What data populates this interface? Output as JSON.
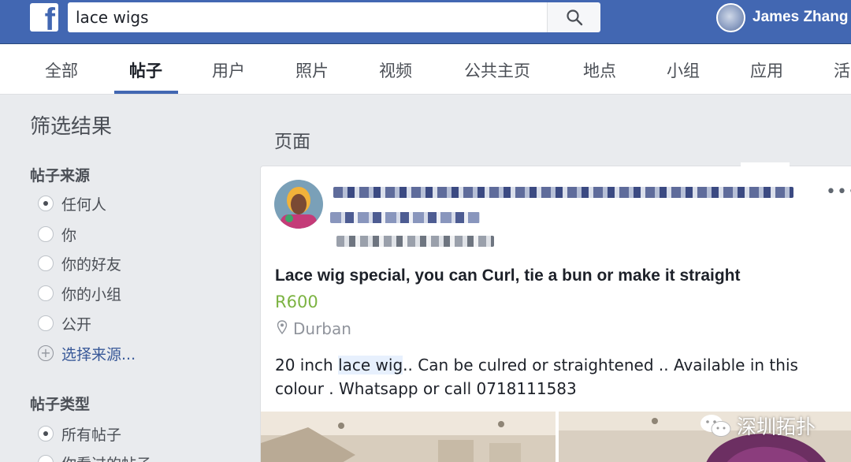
{
  "header": {
    "logo": "f",
    "search_value": "lace wigs",
    "user_name": "James Zhang"
  },
  "tabs": [
    {
      "label": "全部"
    },
    {
      "label": "帖子"
    },
    {
      "label": "用户"
    },
    {
      "label": "照片"
    },
    {
      "label": "视频"
    },
    {
      "label": "公共主页"
    },
    {
      "label": "地点"
    },
    {
      "label": "小组"
    },
    {
      "label": "应用"
    },
    {
      "label": "活"
    }
  ],
  "active_tab": "帖子",
  "filters": {
    "title": "筛选结果",
    "source": {
      "title": "帖子来源",
      "options": [
        {
          "label": "任何人",
          "selected": true
        },
        {
          "label": "你",
          "selected": false
        },
        {
          "label": "你的好友",
          "selected": false
        },
        {
          "label": "你的小组",
          "selected": false
        },
        {
          "label": "公开",
          "selected": false
        }
      ],
      "choose_label": "选择来源..."
    },
    "type": {
      "title": "帖子类型",
      "options": [
        {
          "label": "所有帖子",
          "selected": true
        },
        {
          "label": "你看过的帖子",
          "selected": false
        }
      ]
    }
  },
  "results": {
    "section_title": "页面",
    "post": {
      "title": "Lace wig special, you can Curl, tie a bun or make it straight",
      "price": "R600",
      "location": "Durban",
      "body_before": "20 inch ",
      "body_highlight": "lace wig",
      "body_after": ".. Can be culred or straightened .. Available in this colour . Whatsapp or call 0718111583",
      "more_label": "•••"
    }
  },
  "watermark": {
    "text": "深圳拓扑"
  },
  "colors": {
    "brand_blue": "#4267b2",
    "price_green": "#7cb342",
    "link_blue": "#385898"
  }
}
